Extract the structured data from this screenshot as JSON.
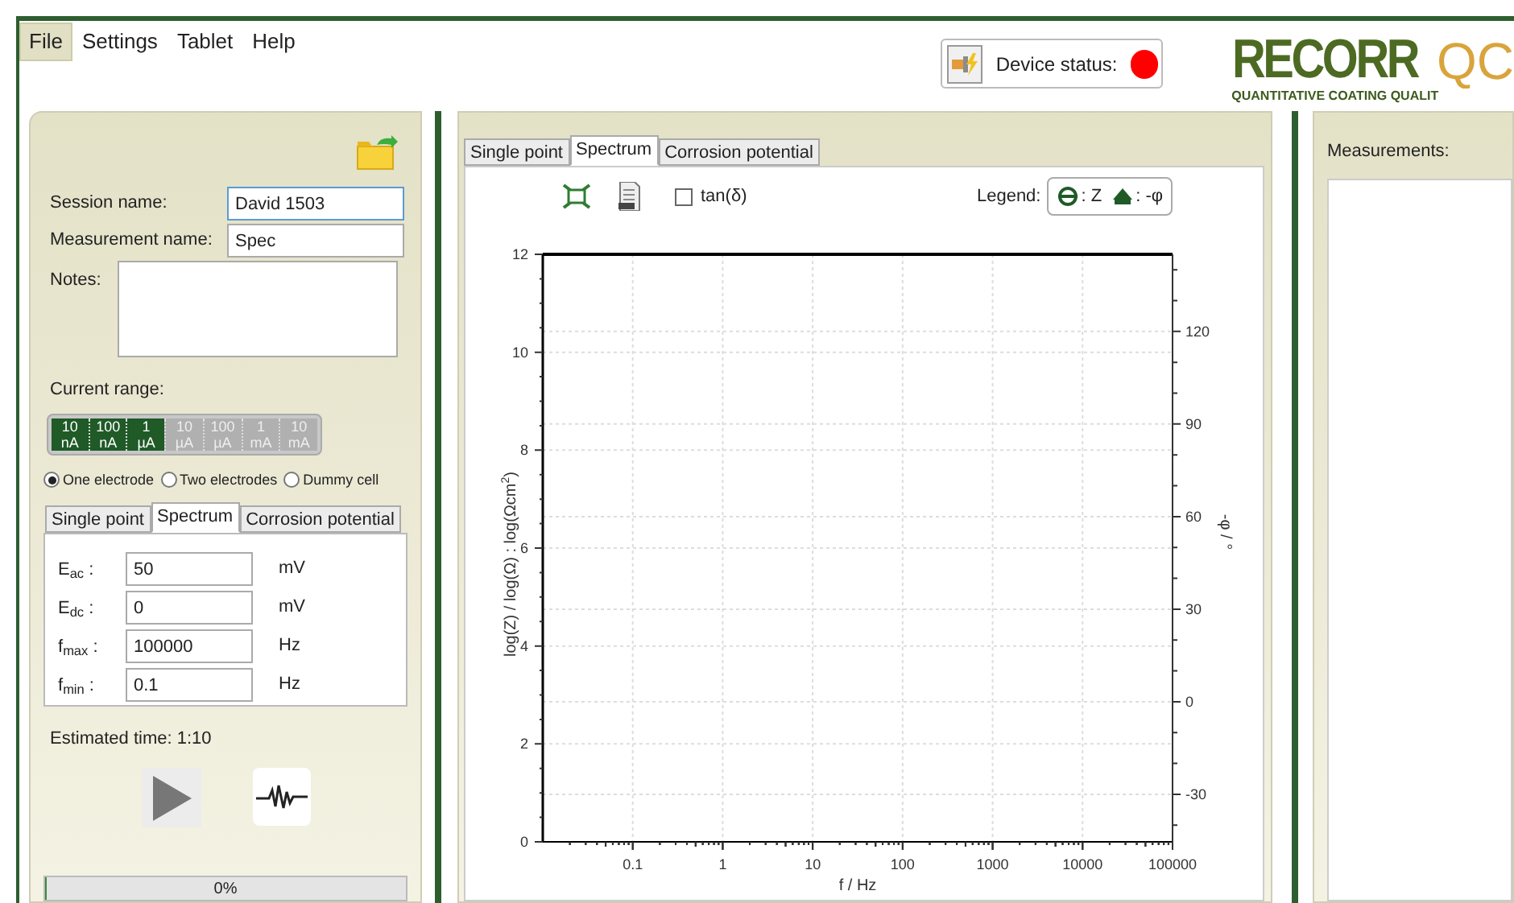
{
  "menu": [
    {
      "label": "File",
      "selected": true
    },
    {
      "label": "Settings",
      "selected": false
    },
    {
      "label": "Tablet",
      "selected": false
    },
    {
      "label": "Help",
      "selected": false
    }
  ],
  "device_status": {
    "label": "Device status:",
    "connected": false
  },
  "logo": {
    "name": "RECORR",
    "suffix": "QC",
    "tagline": "QUANTITATIVE COATING QUALIT"
  },
  "session": {
    "fields": [
      {
        "label": "Session name:",
        "value": "David 1503",
        "focused": true
      },
      {
        "label": "Measurement name:",
        "value": "Spec",
        "focused": false
      }
    ],
    "notes_label": "Notes:"
  },
  "current_range": {
    "label": "Current range:",
    "segments": [
      {
        "value": "10",
        "unit": "nA",
        "selected": true
      },
      {
        "value": "100",
        "unit": "nA",
        "selected": true
      },
      {
        "value": "1",
        "unit": "µA",
        "selected": true
      },
      {
        "value": "10",
        "unit": "µA",
        "selected": false
      },
      {
        "value": "100",
        "unit": "µA",
        "selected": false
      },
      {
        "value": "1",
        "unit": "mA",
        "selected": false
      },
      {
        "value": "10",
        "unit": "mA",
        "selected": false
      }
    ]
  },
  "electrodes": [
    {
      "label": "One electrode",
      "selected": true
    },
    {
      "label": "Two electrodes",
      "selected": false
    },
    {
      "label": "Dummy cell",
      "selected": false
    }
  ],
  "settings_tabs": [
    {
      "label": "Single point",
      "selected": false
    },
    {
      "label": "Spectrum",
      "selected": true
    },
    {
      "label": "Corrosion potential",
      "selected": false
    }
  ],
  "parameters": [
    {
      "label": "E$_{ac}$ :",
      "value": "50",
      "unit": "mV"
    },
    {
      "label": "E$_{dc}$ :",
      "value": "0",
      "unit": "mV"
    },
    {
      "label": "f$_{max}$ :",
      "value": "100000",
      "unit": "Hz"
    },
    {
      "label": "f$_{min}$ :",
      "value": "0.1",
      "unit": "Hz"
    }
  ],
  "estimated_time": "Estimated time: 1:10",
  "progress": {
    "text": "0%",
    "level": 0
  },
  "plot_tabs": [
    {
      "label": "Single point",
      "selected": false
    },
    {
      "label": "Spectrum",
      "selected": true
    },
    {
      "label": "Corrosion potential",
      "selected": false
    }
  ],
  "toolbar": {
    "checkbox": {
      "label": "tan(δ)",
      "checked": false
    },
    "legend_label": "Legend:",
    "legend": [
      {
        "kind": "circle",
        "text": ": Z"
      },
      {
        "kind": "triangle",
        "text": ": -φ"
      }
    ]
  },
  "chart_data": {
    "type": "scatter",
    "xlabel": "f / Hz",
    "ylabel": "log(Z) / log(Ω) : log(Ωcm$^{2}$)",
    "grid": true,
    "categories": [
      null,
      "0.1",
      "1",
      "10",
      "100",
      "1000",
      "10000",
      "100000"
    ],
    "ylim": [
      0,
      12
    ],
    "yticks": [
      0,
      2,
      4,
      6,
      8,
      10,
      12
    ],
    "y2label": "-φ / °",
    "y2lim": [
      -45.4,
      145
    ],
    "y2ticks": [
      -30,
      0,
      30,
      60,
      90,
      120
    ]
  },
  "measurements": {
    "label": "Measurements:"
  }
}
